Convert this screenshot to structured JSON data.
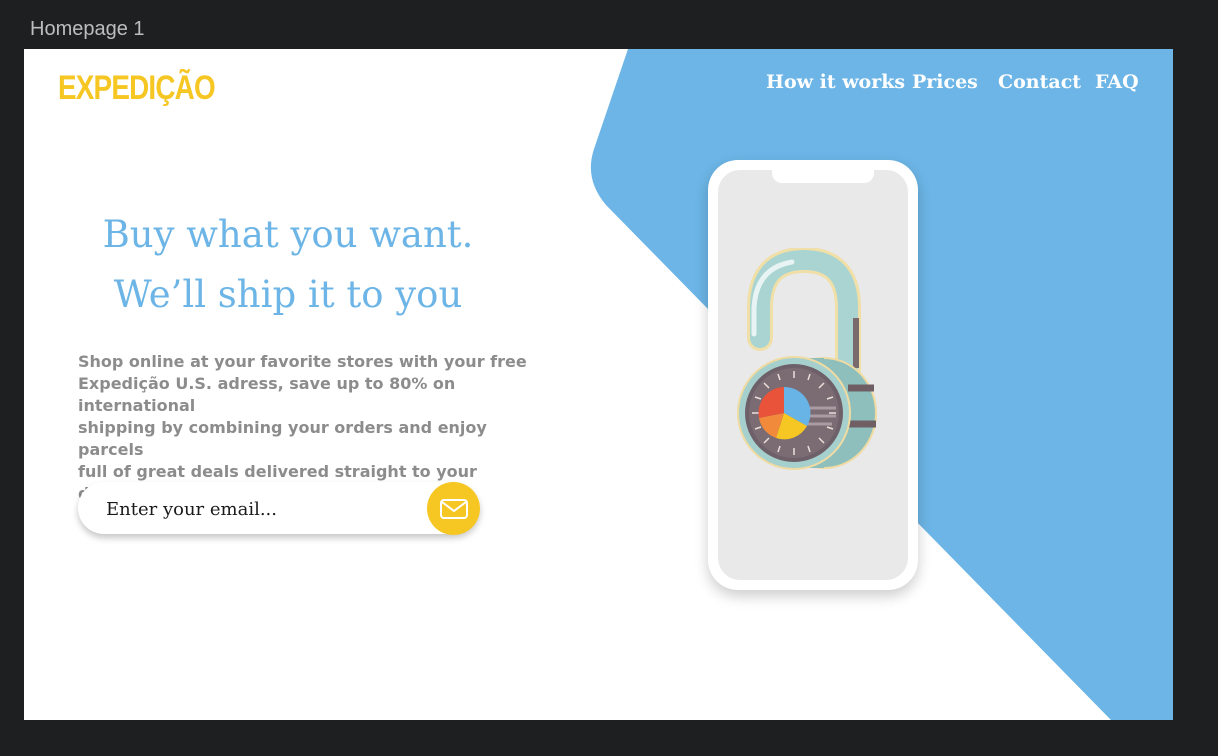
{
  "frame": {
    "label": "Homepage 1"
  },
  "brand": {
    "logo": "EXPEDIÇÃO"
  },
  "nav": {
    "items": [
      {
        "label": "How it works"
      },
      {
        "label": "Prices"
      },
      {
        "label": "Contact"
      },
      {
        "label": "FAQ"
      }
    ]
  },
  "hero": {
    "headline_line1": "Buy what you want.",
    "headline_line2": "We’ll ship it to you",
    "body": " Shop online at your favorite stores with your free\nExpedição U.S. adress, save up to 80% on international\nshipping by combining your orders and enjoy parcels\nfull of great deals delivered straight to your doorstep.",
    "email_placeholder": "Enter your email...",
    "submit_icon": "mail-icon"
  },
  "illustration": {
    "phone_icon": "smartphone-icon",
    "lock_icon": "open-padlock-icon"
  },
  "colors": {
    "brand_yellow": "#f6c623",
    "accent_blue": "#6cb5e6",
    "text_gray": "#8c8c8c",
    "page_bg": "#ffffff",
    "canvas_bg": "#1e1f21"
  }
}
